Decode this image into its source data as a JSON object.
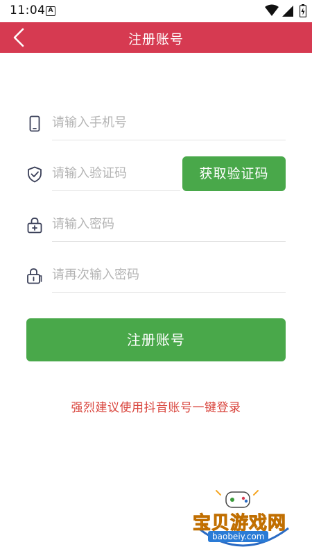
{
  "status_bar": {
    "time": "11:04",
    "notification_glyph": "A",
    "icons": [
      "wifi-icon",
      "signal-icon",
      "battery-icon"
    ]
  },
  "app_bar": {
    "title": "注册账号",
    "back_icon": "chevron-left-icon",
    "background": "#d63a51"
  },
  "form": {
    "phone": {
      "placeholder": "请输入手机号",
      "value": "",
      "icon": "phone-icon"
    },
    "code": {
      "placeholder": "请输入验证码",
      "value": "",
      "icon": "shield-check-icon"
    },
    "password": {
      "placeholder": "请输入密码",
      "value": "",
      "icon": "lock-plus-icon"
    },
    "confirm_password": {
      "placeholder": "请再次输入密码",
      "value": "",
      "icon": "lock-icon"
    },
    "get_code_label": "获取验证码",
    "submit_label": "注册账号",
    "accent": "#49a84a"
  },
  "douyin_login": {
    "label": "强烈建议使用抖音账号一键登录",
    "color": "#d9453d"
  },
  "watermark": {
    "name": "宝贝游戏网",
    "url": "baobeiy.com"
  }
}
